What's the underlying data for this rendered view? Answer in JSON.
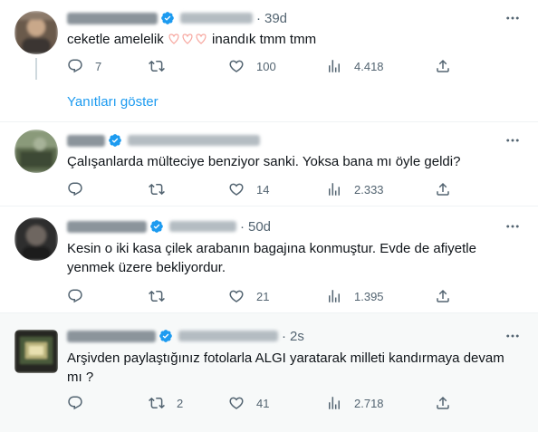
{
  "tweets": [
    {
      "time": "39d",
      "text_before": "ceketle amelelik ",
      "text_after": " inandık tmm tmm",
      "emoji": "white-heart-outline-emoji",
      "replies": "7",
      "retweets": "",
      "likes": "100",
      "views": "4.418",
      "show_replies_label": "Yanıtları göster"
    },
    {
      "time": "",
      "text": "Çalışanlarda mülteciye benziyor sanki. Yoksa bana mı öyle geldi?",
      "replies": "",
      "retweets": "",
      "likes": "14",
      "views": "2.333"
    },
    {
      "time": "50d",
      "text_line1": "Kesin o iki kasa çilek arabanın bagajına konmuştur. Evde de afiyetle",
      "text_line2": "yenmek üzere bekliyordur.",
      "replies": "",
      "retweets": "",
      "likes": "21",
      "views": "1.395"
    },
    {
      "time": "2s",
      "text_line1": "Arşivden paylaştığınız fotolarla ALGI yaratarak milleti kandırmaya devam",
      "text_line2": "mı ?",
      "replies": "",
      "retweets": "2",
      "likes": "41",
      "views": "2.718"
    }
  ],
  "icons": {
    "reply": "reply-icon",
    "retweet": "retweet-icon",
    "like": "like-icon",
    "views": "views-icon",
    "share": "share-icon",
    "more": "more-icon",
    "verified": "verified-badge-icon"
  },
  "colors": {
    "accent": "#1d9bf0",
    "muted": "#536471",
    "text": "#0f1419",
    "highlight_bg": "#f7f9f9"
  }
}
